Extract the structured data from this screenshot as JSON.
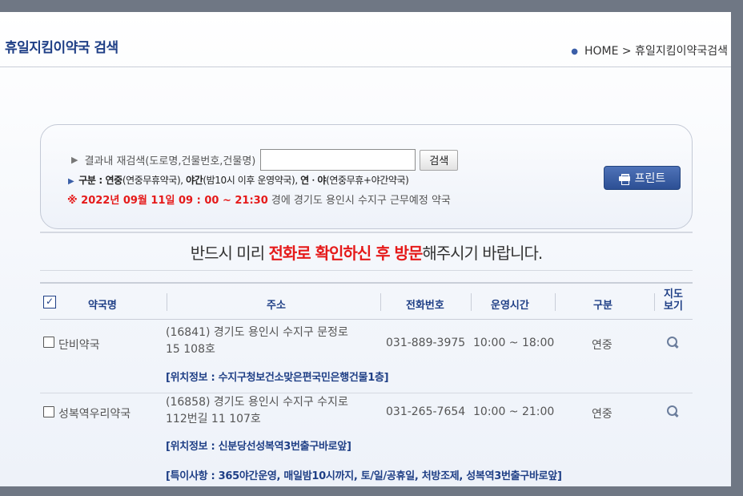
{
  "header": {
    "title": "휴일지킴이약국 검색",
    "breadcrumb_home": "HOME",
    "breadcrumb_sep": ">",
    "breadcrumb_current": "휴일지킴이약국검색"
  },
  "search": {
    "label": "결과내 재검색(도로명,건물번호,건물명)",
    "input_value": "",
    "button_label": "검색",
    "legend_prefix": "구분 : ",
    "legend_a_bold": "연중",
    "legend_a_desc": "(연중무휴약국), ",
    "legend_b_bold": "야간",
    "legend_b_desc": "(밤10시 이후 운영약국), ",
    "legend_c_bold": "연ㆍ야",
    "legend_c_desc": "(연중무휴+야간약국)",
    "date_text": "※ 2022년 09월 11일 09 : 00 ~ 21:30",
    "date_suffix": " 경에  경기도  용인시 수지구   근무예정 약국",
    "print_label": "프린트"
  },
  "notice": {
    "pre": "반드시 미리 ",
    "emph": "전화로 확인하신 후 방문",
    "post": "해주시기 바랍니다."
  },
  "table": {
    "headers": {
      "name": "약국명",
      "address": "주소",
      "phone": "전화번호",
      "hours": "운영시간",
      "kind": "구분",
      "map_line1": "지도",
      "map_line2": "보기"
    },
    "rows": [
      {
        "name": "단비약국",
        "address_line1": "(16841) 경기도 용인시 수지구 문정로",
        "address_line2": "15 108호",
        "phone": "031-889-3975",
        "hours": "10:00 ~ 18:00",
        "kind": "연중",
        "location": "[위치정보 : 수지구청보건소맞은편국민은행건물1층]"
      },
      {
        "name": "성복역우리약국",
        "address_line1": "(16858) 경기도 용인시 수지구 수지로",
        "address_line2": "112번길 11 107호",
        "phone": "031-265-7654",
        "hours": "10:00 ~ 21:00",
        "kind": "연중",
        "location": "[위치정보 : 신분당선성복역3번출구바로앞]",
        "special": "[특이사항 : 365야간운영, 매일밤10시까지, 토/일/공휴일, 처방조제, 성복역3번출구바로앞]"
      }
    ]
  }
}
